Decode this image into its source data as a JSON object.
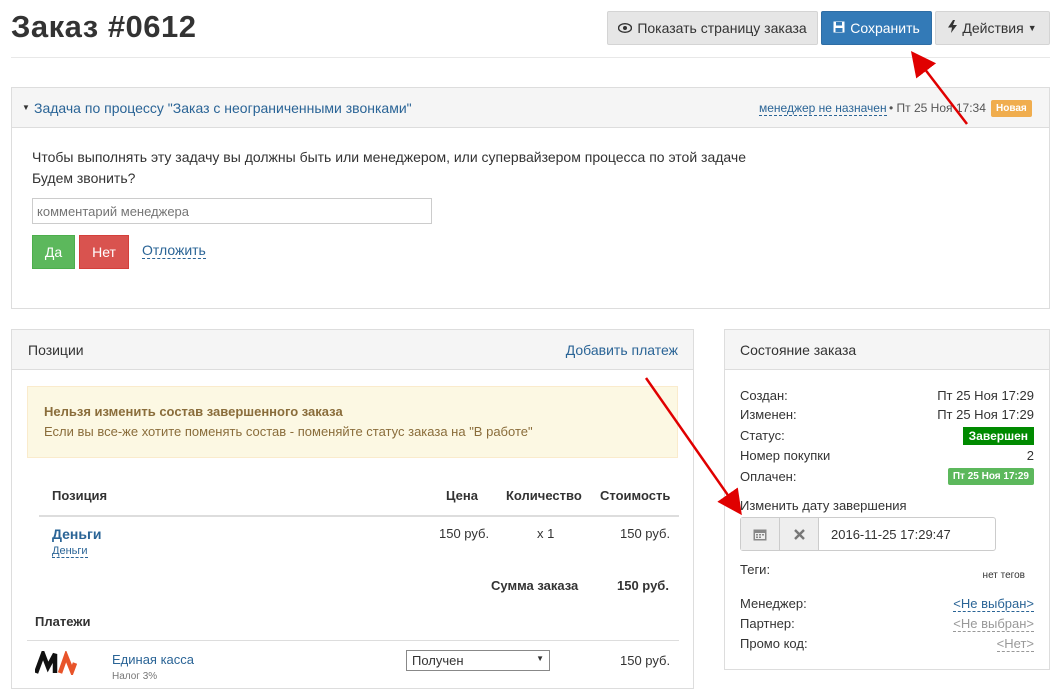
{
  "page": {
    "title": "Заказ #0612"
  },
  "toolbar": {
    "show_page": "Показать страницу заказа",
    "save": "Сохранить",
    "actions": "Действия"
  },
  "task": {
    "title": "Задача по процессу \"Заказ с неограниченными звонками\"",
    "manager": "менеджер не назначен",
    "datetime": "• Пт 25 Ноя 17:34",
    "badge": "Новая",
    "notice": "Чтобы выполнять эту задачу вы должны быть или менеджером, или супервайзером процесса по этой задаче",
    "question": "Будем звонить?",
    "comment_placeholder": "комментарий менеджера",
    "yes": "Да",
    "no": "Нет",
    "postpone": "Отложить"
  },
  "positions": {
    "header": "Позиции",
    "add_payment": "Добавить платеж",
    "warning_title": "Нельзя изменить состав завершенного заказа",
    "warning_text": "Если вы все-же хотите поменять состав - поменяйте статус заказа на \"В работе\"",
    "columns": {
      "item": "Позиция",
      "price": "Цена",
      "qty": "Количество",
      "cost": "Стоимость"
    },
    "items": [
      {
        "name": "Деньги",
        "sub": "Деньги",
        "price": "150 руб.",
        "qty": "x 1",
        "cost": "150 руб."
      }
    ],
    "total_label": "Сумма заказа",
    "total_value": "150 руб.",
    "payments_header": "Платежи",
    "payments": [
      {
        "name": "Единая касса",
        "tax": "Налог 3%",
        "status": "Получен",
        "amount": "150 руб."
      }
    ]
  },
  "state": {
    "header": "Состояние заказа",
    "created_label": "Создан:",
    "created_value": "Пт 25 Ноя 17:29",
    "changed_label": "Изменен:",
    "changed_value": "Пт 25 Ноя 17:29",
    "status_label": "Статус:",
    "status_value": "Завершен",
    "purchase_label": "Номер покупки",
    "purchase_value": "2",
    "paid_label": "Оплачен:",
    "paid_value": "Пт 25 Ноя 17:29",
    "change_date_label": "Изменить дату завершения",
    "date_value": "2016-11-25 17:29:47",
    "tags_label": "Теги:",
    "tags_value": "нет тегов",
    "manager_label": "Менеджер:",
    "manager_value": "<Не выбран>",
    "partner_label": "Партнер:",
    "partner_value": "<Не выбран>",
    "promo_label": "Промо код:",
    "promo_value": "<Нет>"
  },
  "colors": {
    "primary": "#337ab7",
    "success": "#5cb85c",
    "danger": "#d9534f",
    "warning": "#f0ad4e",
    "arrow": "#e00000"
  }
}
